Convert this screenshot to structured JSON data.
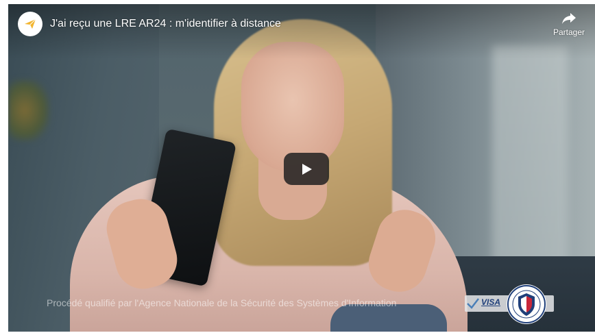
{
  "video": {
    "title": "J'ai reçu une LRE AR24 : m'identifier à distance",
    "share_label": "Partager",
    "certification_text": "Procédé qualifié par l'Agence Nationale de la Sécurité des Systèmes d'Information",
    "visa_label": "VISA"
  },
  "icons": {
    "channel": "paper-plane-icon",
    "share": "share-arrow-icon",
    "play": "play-icon",
    "visa_check": "checkmark-icon",
    "seal": "anssi-seal-icon"
  },
  "colors": {
    "channel_icon": "#f2b530",
    "play_bg": "#212121",
    "visa_text": "#1f3f7a",
    "seal_blue": "#1f3f7a",
    "seal_red": "#c8273a"
  }
}
